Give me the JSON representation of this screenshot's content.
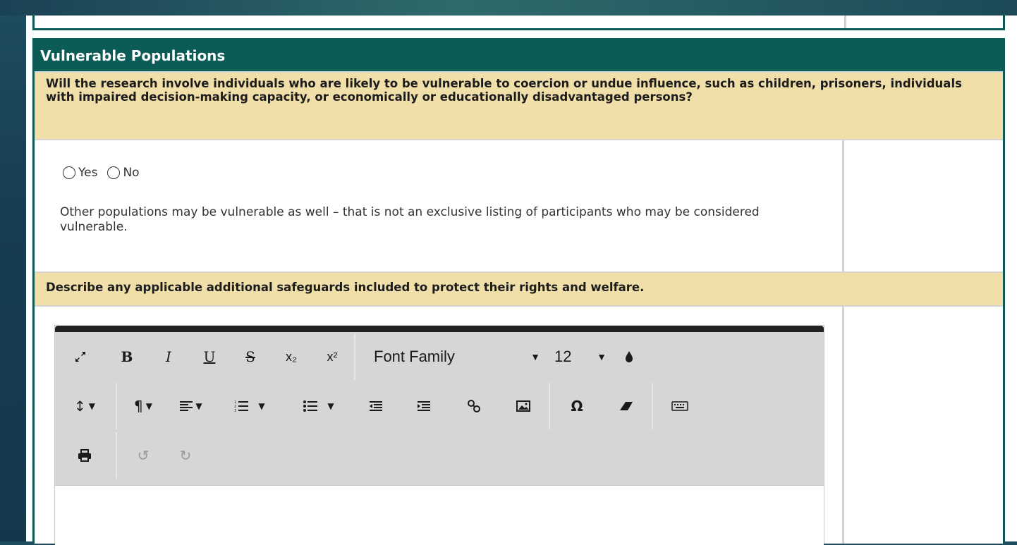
{
  "section": {
    "title": "Vulnerable Populations"
  },
  "question1": {
    "text": "Will the research involve individuals who are likely to be vulnerable to coercion or undue influence, such as children, prisoners, individuals with impaired decision-making capacity, or economically or educationally disadvantaged persons?",
    "options": [
      "Yes",
      "No"
    ],
    "note": "Other populations may be vulnerable as well – that is not an exclusive listing of participants who may be considered vulnerable."
  },
  "question2": {
    "text": "Describe any applicable additional safeguards included to protect their rights and welfare."
  },
  "editor": {
    "font_family_label": "Font Family",
    "font_size_label": "12",
    "bold_label": "B",
    "italic_label": "I",
    "underline_label": "U",
    "strike_label": "S",
    "subscript_label": "x₂",
    "superscript_label": "x²",
    "special_char_label": "Ω",
    "icons": [
      "fullscreen-icon",
      "bold-icon",
      "italic-icon",
      "underline-icon",
      "strikethrough-icon",
      "subscript-icon",
      "superscript-icon",
      "color-icon",
      "line-height-icon",
      "paragraph-icon",
      "align-icon",
      "ordered-list-icon",
      "unordered-list-icon",
      "outdent-icon",
      "indent-icon",
      "link-icon",
      "image-icon",
      "special-char-icon",
      "eraser-icon",
      "keyboard-icon",
      "print-icon",
      "undo-icon",
      "redo-icon"
    ]
  }
}
